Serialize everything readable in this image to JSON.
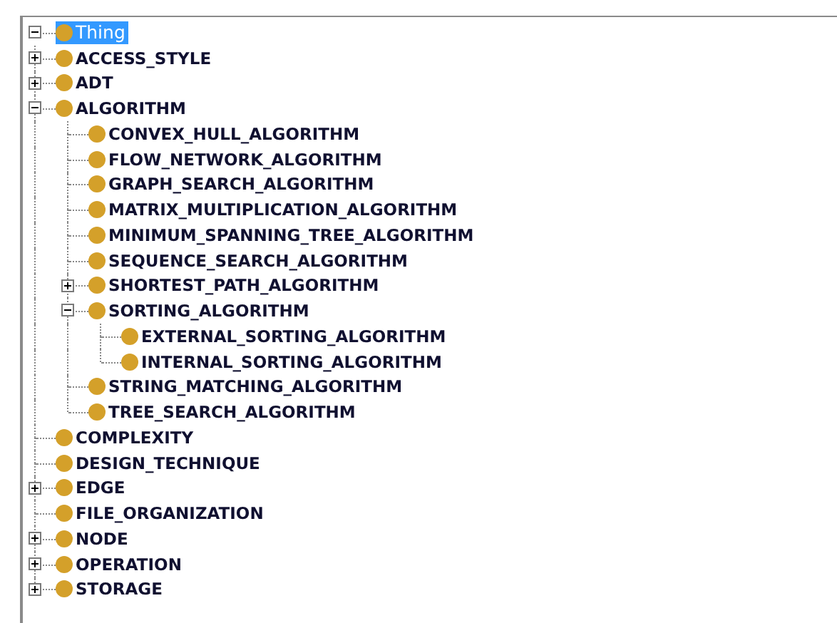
{
  "tree": {
    "label": "Thing",
    "selected": true,
    "expanded": true,
    "children": [
      {
        "label": "ACCESS_STYLE",
        "selected": false,
        "expanded": false
      },
      {
        "label": "ADT",
        "selected": false,
        "expanded": false
      },
      {
        "label": "ALGORITHM",
        "selected": false,
        "expanded": true,
        "children": [
          {
            "label": "CONVEX_HULL_ALGORITHM",
            "selected": false
          },
          {
            "label": "FLOW_NETWORK_ALGORITHM",
            "selected": false
          },
          {
            "label": "GRAPH_SEARCH_ALGORITHM",
            "selected": false
          },
          {
            "label": "MATRIX_MULTIPLICATION_ALGORITHM",
            "selected": false
          },
          {
            "label": "MINIMUM_SPANNING_TREE_ALGORITHM",
            "selected": false
          },
          {
            "label": "SEQUENCE_SEARCH_ALGORITHM",
            "selected": false
          },
          {
            "label": "SHORTEST_PATH_ALGORITHM",
            "selected": false,
            "expanded": false
          },
          {
            "label": "SORTING_ALGORITHM",
            "selected": false,
            "expanded": true,
            "children": [
              {
                "label": "EXTERNAL_SORTING_ALGORITHM",
                "selected": false
              },
              {
                "label": "INTERNAL_SORTING_ALGORITHM",
                "selected": false
              }
            ]
          },
          {
            "label": "STRING_MATCHING_ALGORITHM",
            "selected": false
          },
          {
            "label": "TREE_SEARCH_ALGORITHM",
            "selected": false
          }
        ]
      },
      {
        "label": "COMPLEXITY",
        "selected": false
      },
      {
        "label": "DESIGN_TECHNIQUE",
        "selected": false
      },
      {
        "label": "EDGE",
        "selected": false,
        "expanded": false
      },
      {
        "label": "FILE_ORGANIZATION",
        "selected": false
      },
      {
        "label": "NODE",
        "selected": false,
        "expanded": false
      },
      {
        "label": "OPERATION",
        "selected": false,
        "expanded": false
      },
      {
        "label": "STORAGE",
        "selected": false,
        "expanded": false
      }
    ]
  }
}
